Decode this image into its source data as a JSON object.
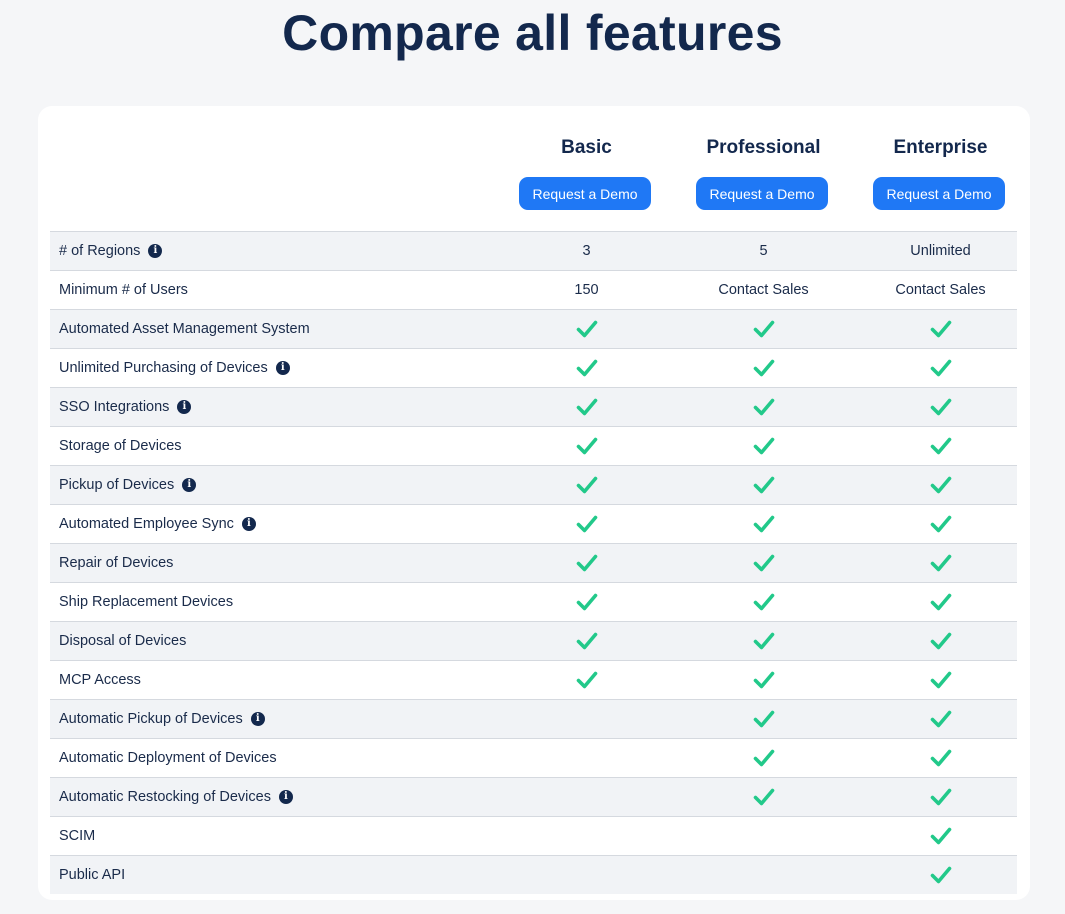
{
  "title": "Compare all features",
  "plans": [
    {
      "name": "Basic",
      "cta": "Request a Demo"
    },
    {
      "name": "Professional",
      "cta": "Request a Demo"
    },
    {
      "name": "Enterprise",
      "cta": "Request a Demo"
    }
  ],
  "colors": {
    "accent": "#1f78f5",
    "check": "#22c98a",
    "heading": "#13284d",
    "row_shade": "#f1f3f6"
  },
  "features": [
    {
      "label": "# of Regions",
      "info": true,
      "values": [
        "3",
        "5",
        "Unlimited"
      ]
    },
    {
      "label": "Minimum # of Users",
      "info": false,
      "values": [
        "150",
        "Contact Sales",
        "Contact Sales"
      ]
    },
    {
      "label": "Automated Asset Management System",
      "info": false,
      "values": [
        true,
        true,
        true
      ]
    },
    {
      "label": "Unlimited Purchasing of Devices",
      "info": true,
      "values": [
        true,
        true,
        true
      ]
    },
    {
      "label": "SSO Integrations",
      "info": true,
      "values": [
        true,
        true,
        true
      ]
    },
    {
      "label": "Storage of Devices",
      "info": false,
      "values": [
        true,
        true,
        true
      ]
    },
    {
      "label": "Pickup of Devices",
      "info": true,
      "values": [
        true,
        true,
        true
      ]
    },
    {
      "label": "Automated Employee Sync",
      "info": true,
      "values": [
        true,
        true,
        true
      ]
    },
    {
      "label": "Repair of Devices",
      "info": false,
      "values": [
        true,
        true,
        true
      ]
    },
    {
      "label": "Ship Replacement Devices",
      "info": false,
      "values": [
        true,
        true,
        true
      ]
    },
    {
      "label": "Disposal of Devices",
      "info": false,
      "values": [
        true,
        true,
        true
      ]
    },
    {
      "label": "MCP Access",
      "info": false,
      "values": [
        true,
        true,
        true
      ]
    },
    {
      "label": "Automatic Pickup of Devices",
      "info": true,
      "values": [
        false,
        true,
        true
      ]
    },
    {
      "label": "Automatic Deployment of Devices",
      "info": false,
      "values": [
        false,
        true,
        true
      ]
    },
    {
      "label": "Automatic Restocking of Devices",
      "info": true,
      "values": [
        false,
        true,
        true
      ]
    },
    {
      "label": "SCIM",
      "info": false,
      "values": [
        false,
        false,
        true
      ]
    },
    {
      "label": "Public API",
      "info": false,
      "values": [
        false,
        false,
        true
      ]
    }
  ]
}
